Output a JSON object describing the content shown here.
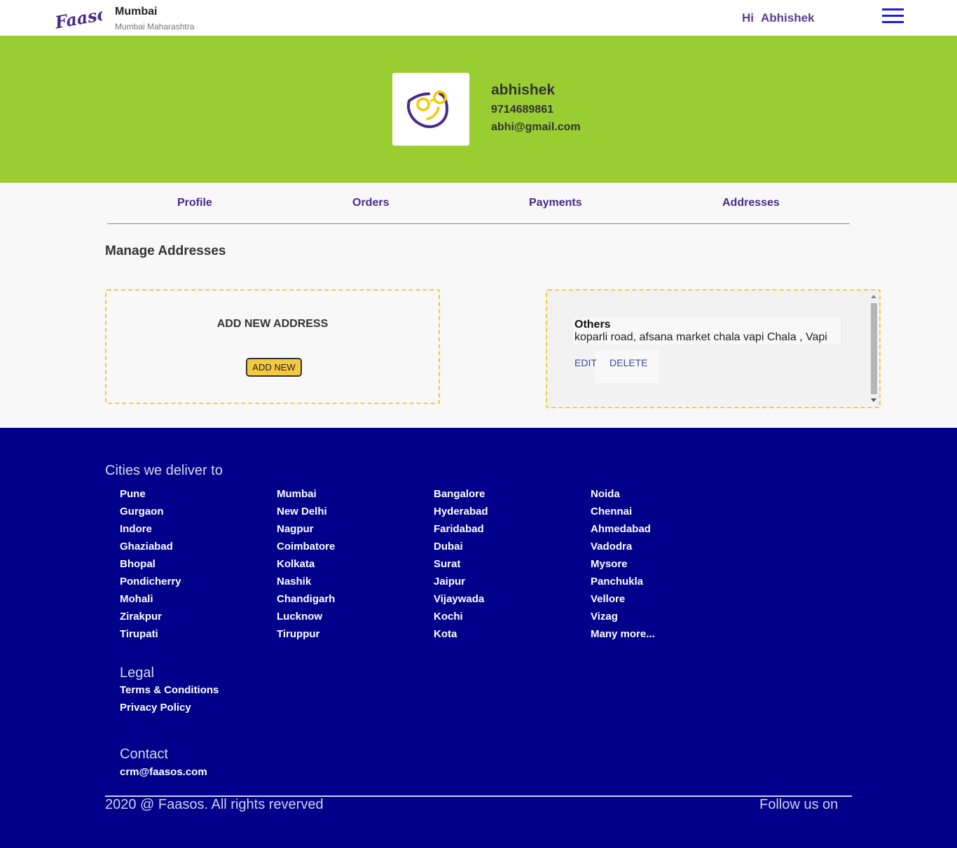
{
  "header": {
    "logo_text": "Faasos",
    "city": "Mumbai",
    "city_sub": "Mumbai Maharashtra",
    "greeting": "Hi",
    "user_name": "Abhishek",
    "menu_icon": "hamburger-menu-icon"
  },
  "profile": {
    "name": "abhishek",
    "phone": "9714689861",
    "email": "abhi@gmail.com",
    "avatar_icon": "smiley-face-icon"
  },
  "tabs": [
    {
      "label": "Profile"
    },
    {
      "label": "Orders"
    },
    {
      "label": "Payments"
    },
    {
      "label": "Addresses"
    }
  ],
  "addresses": {
    "section_title": "Manage Addresses",
    "add_card_title": "ADD NEW ADDRESS",
    "add_button": "ADD NEW",
    "saved": [
      {
        "label": "Others",
        "text": "koparli road, afsana market chala vapi Chala , Vapi",
        "edit": "EDIT",
        "delete": "DELETE"
      }
    ]
  },
  "footer": {
    "cities_title": "Cities we deliver to",
    "cities": [
      [
        "Pune",
        "Gurgaon",
        "Indore",
        "Ghaziabad",
        "Bhopal",
        "Pondicherry",
        "Mohali",
        "Zirakpur",
        "Tirupati"
      ],
      [
        "Mumbai",
        "New Delhi",
        "Nagpur",
        "Coimbatore",
        "Kolkata",
        "Nashik",
        "Chandigarh",
        "Lucknow",
        "Tiruppur"
      ],
      [
        "Bangalore",
        "Hyderabad",
        "Faridabad",
        "Dubai",
        "Surat",
        "Jaipur",
        "Vijaywada",
        "Kochi",
        "Kota"
      ],
      [
        "Noida",
        "Chennai",
        "Ahmedabad",
        "Vadodra",
        "Mysore",
        "Panchukla",
        "Vellore",
        "Vizag",
        "Many more..."
      ]
    ],
    "legal_title": "Legal",
    "legal_links": [
      "Terms & Conditions",
      "Privacy Policy"
    ],
    "contact_title": "Contact",
    "contact_email": "crm@faasos.com",
    "copyright": "2020 @ Faasos. All rights reverved",
    "follow": "Follow us on"
  },
  "colors": {
    "brand_purple": "#5b3b8c",
    "banner_green": "#9acd32",
    "accent_yellow": "#f5c842",
    "footer_navy": "#00008b",
    "menu_blue": "#1a1aee"
  }
}
